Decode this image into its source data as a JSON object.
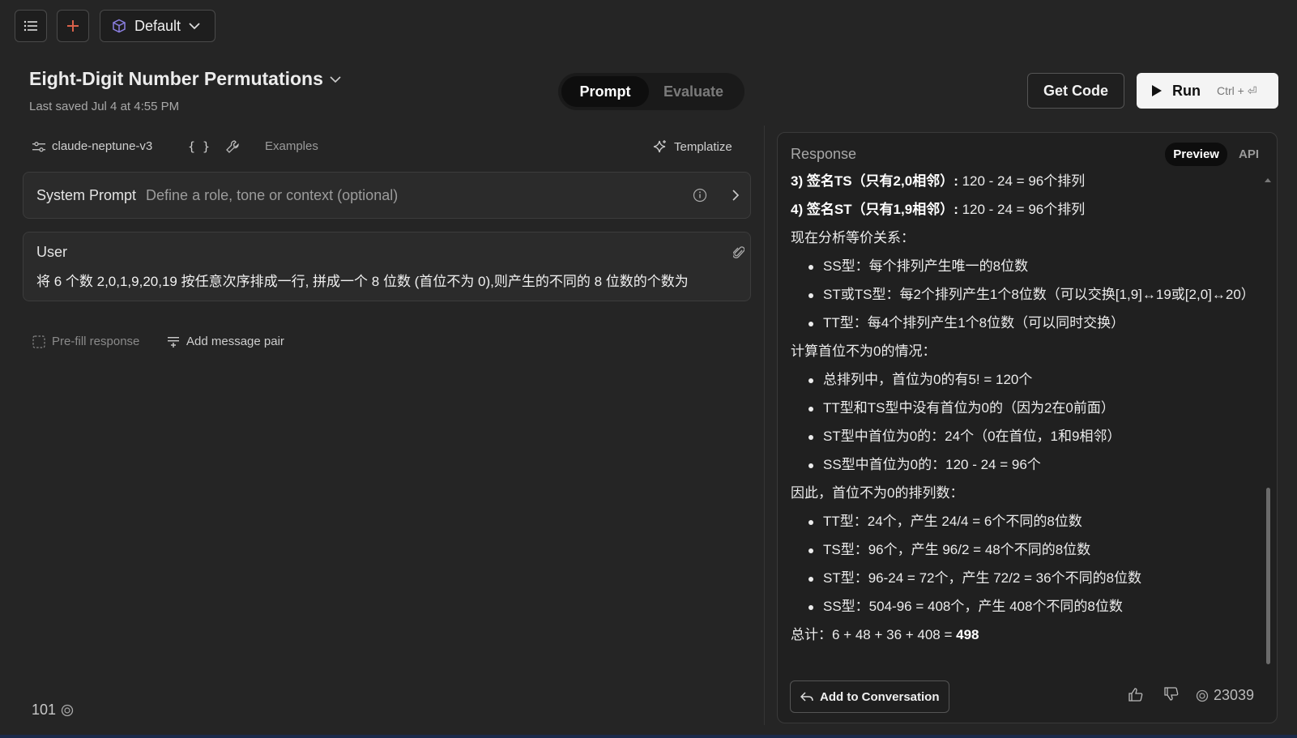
{
  "topbar": {
    "workspace_label": "Default"
  },
  "prompt": {
    "title": "Eight-Digit Number Permutations",
    "last_saved": "Last saved Jul 4 at 4:55 PM"
  },
  "mode_tabs": {
    "prompt": "Prompt",
    "evaluate": "Evaluate"
  },
  "actions": {
    "get_code": "Get Code",
    "run": "Run",
    "run_shortcut": "Ctrl + ⏎"
  },
  "left_toolbar": {
    "model": "claude-neptune-v3",
    "variables": "{ }",
    "examples": "Examples",
    "templatize": "Templatize"
  },
  "system_prompt": {
    "label": "System Prompt",
    "placeholder": "Define a role, tone or context (optional)"
  },
  "user_message": {
    "label": "User",
    "text": "将 6 个数 2,0,1,9,20,19 按任意次序排成一行, 拼成一个 8 位数 (首位不为 0),则产生的不同的 8 位数的个数为"
  },
  "left_actions": {
    "prefill": "Pre-fill response",
    "add_pair": "Add message pair"
  },
  "token_count": "101",
  "response": {
    "header": "Response",
    "view_preview": "Preview",
    "view_api": "API",
    "line1_bold": "3) 签名TS（只有2,0相邻）:",
    "line1_rest": " 120 - 24 = 96个排列",
    "line2_bold": "4) 签名ST（只有1,9相邻）:",
    "line2_rest": " 120 - 24 = 96个排列",
    "para1": "现在分析等价关系：",
    "list1": [
      "SS型：每个排列产生唯一的8位数",
      "ST或TS型：每2个排列产生1个8位数（可以交换[1,9]↔19或[2,0]↔20）",
      "TT型：每4个排列产生1个8位数（可以同时交换）"
    ],
    "para2": "计算首位不为0的情况：",
    "list2": [
      "总排列中，首位为0的有5! = 120个",
      "TT型和TS型中没有首位为0的（因为2在0前面）",
      "ST型中首位为0的：24个（0在首位，1和9相邻）",
      "SS型中首位为0的：120 - 24 = 96个"
    ],
    "para3": "因此，首位不为0的排列数：",
    "list3": [
      "TT型：24个，产生 24/4 = 6个不同的8位数",
      "TS型：96个，产生 96/2 = 48个不同的8位数",
      "ST型：96-24 = 72个，产生 72/2 = 36个不同的8位数",
      "SS型：504-96 = 408个，产生 408个不同的8位数"
    ],
    "total_prefix": "总计：6 + 48 + 36 + 408 = ",
    "total_value": "498",
    "add_to_conversation": "Add to Conversation",
    "response_tokens": "23039"
  }
}
